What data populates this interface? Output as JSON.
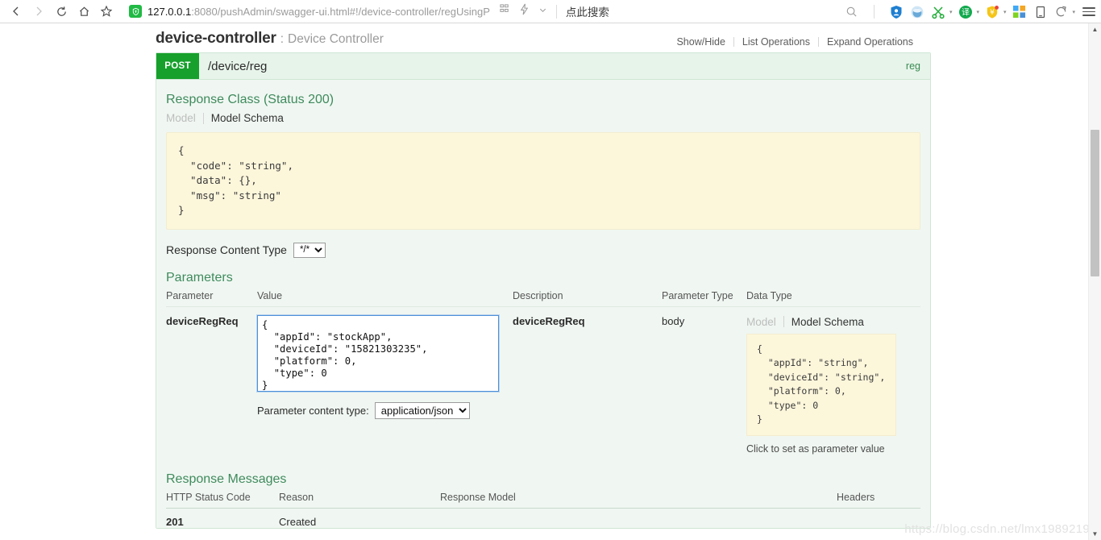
{
  "browser": {
    "back_icon": "back-arrow-icon",
    "forward_icon": "forward-arrow-icon",
    "reload_icon": "reload-icon",
    "home_icon": "home-icon",
    "bookmark_icon": "star-icon",
    "url_prefix": "127.0.0.1",
    "url_host": "127.0.0.1",
    "url_rest": ":8080/pushAdmin/swagger-ui.html#!/device-controller/regUsingP",
    "search_placeholder": "点此搜索",
    "extensions": [
      "shield-icon",
      "globe-icon",
      "scissors-icon",
      "translate-icon",
      "wallet-icon",
      "apps-grid-icon",
      "tablet-icon",
      "history-icon",
      "menu-icon"
    ]
  },
  "resource": {
    "name": "device-controller",
    "separator": ":",
    "description": "Device Controller",
    "links": [
      "Show/Hide",
      "List Operations",
      "Expand Operations"
    ]
  },
  "operation": {
    "method": "POST",
    "path": "/device/reg",
    "nickname": "reg"
  },
  "response_class": {
    "heading": "Response Class (Status 200)",
    "tab_model": "Model",
    "tab_schema": "Model Schema",
    "schema": "{\n  \"code\": \"string\",\n  \"data\": {},\n  \"msg\": \"string\"\n}"
  },
  "response_content_type": {
    "label": "Response Content Type",
    "value": "*/*",
    "options": [
      "*/*"
    ]
  },
  "parameters": {
    "heading": "Parameters",
    "columns": [
      "Parameter",
      "Value",
      "Description",
      "Parameter Type",
      "Data Type"
    ],
    "rows": [
      {
        "parameter": "deviceRegReq",
        "value": "{\n  \"appId\": \"stockApp\",\n  \"deviceId\": \"15821303235\",\n  \"platform\": 0,\n  \"type\": 0\n}",
        "description": "deviceRegReq",
        "parameter_type": "body",
        "content_type_label": "Parameter content type:",
        "content_type_value": "application/json",
        "content_type_options": [
          "application/json"
        ],
        "data_type": {
          "tab_model": "Model",
          "tab_schema": "Model Schema",
          "schema": "{\n  \"appId\": \"string\",\n  \"deviceId\": \"string\",\n  \"platform\": 0,\n  \"type\": 0\n}",
          "hint": "Click to set as parameter value"
        }
      }
    ]
  },
  "response_messages": {
    "heading": "Response Messages",
    "columns": [
      "HTTP Status Code",
      "Reason",
      "Response Model",
      "Headers"
    ],
    "rows": [
      {
        "code": "201",
        "reason": "Created",
        "model": "",
        "headers": ""
      }
    ]
  },
  "watermark": "https://blog.csdn.net/lmx1989219",
  "colors": {
    "method_green": "#17a02c",
    "panel_green": "#f0f7f2",
    "code_cream": "#fcf6db",
    "heading_green": "#3f8a5d",
    "focus_blue": "#4d90d9"
  }
}
